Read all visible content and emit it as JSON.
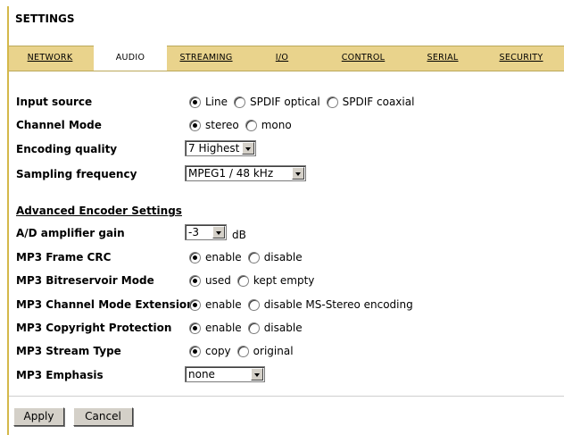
{
  "title": "SETTINGS",
  "tabs": [
    "NETWORK",
    "AUDIO",
    "STREAMING",
    "I/O",
    "CONTROL",
    "SERIAL",
    "SECURITY"
  ],
  "active_tab": "AUDIO",
  "settings": {
    "input_source": {
      "label": "Input source",
      "options": [
        "Line",
        "SPDIF optical",
        "SPDIF coaxial"
      ],
      "selected": "Line"
    },
    "channel_mode": {
      "label": "Channel Mode",
      "options": [
        "stereo",
        "mono"
      ],
      "selected": "stereo"
    },
    "encoding_quality": {
      "label": "Encoding quality",
      "value": "7 Highest"
    },
    "sampling_frequency": {
      "label": "Sampling frequency",
      "value": "MPEG1 / 48 kHz"
    }
  },
  "advanced": {
    "heading": "Advanced Encoder Settings",
    "ad_gain": {
      "label": "A/D amplifier gain",
      "value": "-3",
      "unit": "dB"
    },
    "frame_crc": {
      "label": "MP3 Frame CRC",
      "options": [
        "enable",
        "disable"
      ],
      "selected": "enable"
    },
    "bitreservoir": {
      "label": "MP3 Bitreservoir Mode",
      "options": [
        "used",
        "kept empty"
      ],
      "selected": "used"
    },
    "channel_ext": {
      "label": "MP3 Channel Mode Extension",
      "options": [
        "enable",
        "disable MS-Stereo encoding"
      ],
      "selected": "enable"
    },
    "copyright": {
      "label": "MP3 Copyright Protection",
      "options": [
        "enable",
        "disable"
      ],
      "selected": "enable"
    },
    "stream_type": {
      "label": "MP3 Stream Type",
      "options": [
        "copy",
        "original"
      ],
      "selected": "copy"
    },
    "emphasis": {
      "label": "MP3 Emphasis",
      "value": "none"
    }
  },
  "buttons": {
    "apply": "Apply",
    "cancel": "Cancel"
  }
}
